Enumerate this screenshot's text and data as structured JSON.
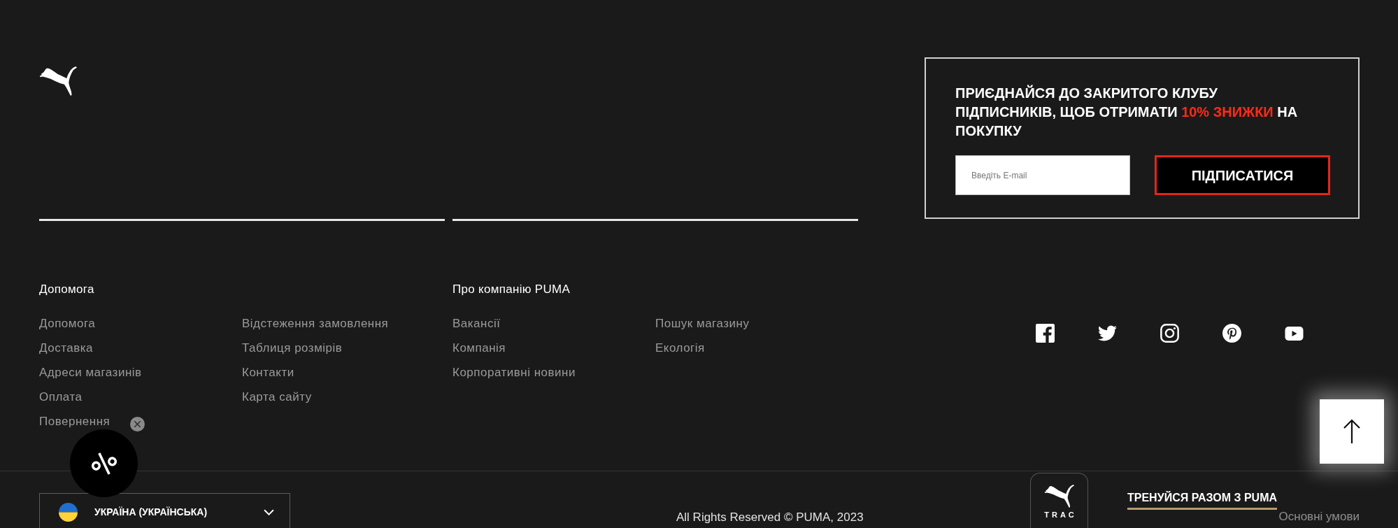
{
  "newsletter": {
    "heading_start": "ПРИЄДНАЙСЯ ДО ЗАКРИТОГО КЛУБУ ПІДПИСНИКІВ, ЩОБ ОТРИМАТИ",
    "heading_highlight": "10% ЗНИЖКИ",
    "heading_end": "НА ПОКУПКУ",
    "email": {
      "placeholder": "Введіть E-mail"
    },
    "subscribe_button": "ПІДПИСАТИСЯ"
  },
  "link_groups": [
    {
      "title": "Допомога",
      "columns": [
        [
          "Допомога",
          "Доставка",
          "Адреси магазинів",
          "Оплата",
          "Повернення"
        ],
        [
          "Відстеження замовлення",
          "Таблиця розмірів",
          "Контакти",
          "Карта сайту"
        ]
      ]
    },
    {
      "title": "Про компанію PUMA",
      "columns": [
        [
          "Вакансії",
          "Компанія",
          "Корпоративні новини"
        ],
        [
          "Пошук магазину",
          "Екологія"
        ]
      ]
    }
  ],
  "bottom_bar": {
    "country_selector": "УКРАЇНА (УКРАЇНСЬКА)",
    "copyright": "All Rights Reserved © PUMA, 2023",
    "app_tile": "TRAC",
    "train_link": "ТРЕНУЙСЯ РАЗОМ З PUMA",
    "terms_link": "Основні умови"
  }
}
